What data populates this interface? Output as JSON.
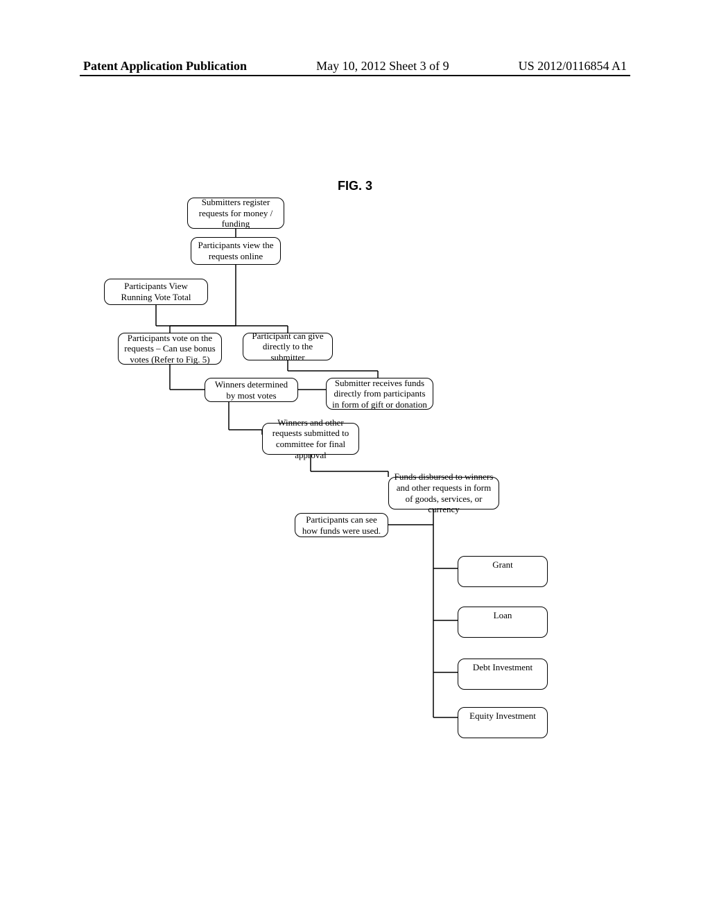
{
  "header": {
    "left": "Patent Application Publication",
    "center": "May 10, 2012  Sheet 3 of 9",
    "right": "US 2012/0116854 A1"
  },
  "figure": {
    "title": "FIG. 3"
  },
  "boxes": {
    "b1": "Submitters register requests for money / funding",
    "b2": "Participants view the requests online",
    "b3": "Participants View Running Vote Total",
    "b4": "Participants vote on the requests – Can use bonus votes (Refer to Fig. 5)",
    "b5": "Participant can give directly to the submitter",
    "b6": "Winners determined by most votes",
    "b7": "Submitter receives funds directly from participants in form of gift or donation",
    "b8": "Winners and other requests submitted to committee for final approval",
    "b9": "Funds disbursed to winners and other requests in form of goods, services, or currency",
    "b10": "Participants can see how funds were used.",
    "b11": "Grant",
    "b12": "Loan",
    "b13": "Debt Investment",
    "b14": "Equity Investment"
  }
}
